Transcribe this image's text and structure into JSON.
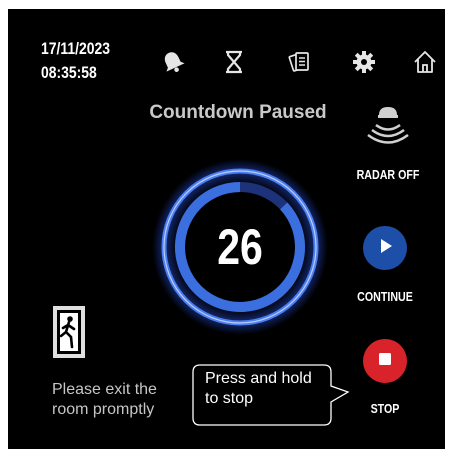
{
  "status": {
    "date": "17/11/2023",
    "time": "08:35:58"
  },
  "toolbar": {
    "icons": [
      "bell-icon",
      "hourglass-icon",
      "documents-icon",
      "gear-icon",
      "home-icon"
    ]
  },
  "countdown": {
    "title": "Countdown Paused",
    "value": "26",
    "progress": 0.87
  },
  "radar": {
    "label": "RADAR OFF"
  },
  "controls": {
    "continue_label": "CONTINUE",
    "stop_label": "STOP",
    "hint_line1": "Press and hold",
    "hint_line2": "to stop"
  },
  "exit": {
    "line1": "Please exit the",
    "line2": "room promptly"
  },
  "colors": {
    "background": "#000000",
    "ring_blue": "#3b6fe0",
    "ring_glow": "#2a52d6",
    "continue_blue": "#1e4fa8",
    "stop_red": "#d8232a"
  }
}
